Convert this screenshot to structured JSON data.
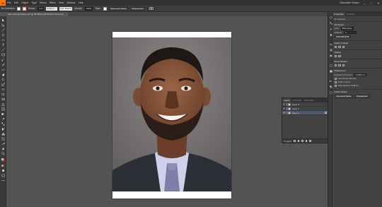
{
  "app": {
    "logo": "Ai",
    "menu": [
      "File",
      "Edit",
      "Object",
      "Type",
      "Select",
      "Effect",
      "View",
      "Window",
      "Help"
    ],
    "workspace": "Essentials Classic",
    "window_controls": [
      "–",
      "□",
      "✕"
    ]
  },
  "controlbar": {
    "selection_label": "No Selection",
    "stroke_label": "Stroke:",
    "stroke_value": "1 pt",
    "stroke_style": "Uniform",
    "brush": "5 pt. Round",
    "opacity_label": "Opacity:",
    "opacity_value": "100%",
    "style_label": "Style:",
    "document_setup": "Document Setup",
    "preferences": "Preferences"
  },
  "document": {
    "tab_title": "will-smith illustration.ai* @ 38.95% (CMYK/GPU Preview)",
    "close": "×"
  },
  "layers_panel": {
    "tabs": [
      "Layers",
      "Artboards",
      "Properties"
    ],
    "layers": [
      {
        "name": "Layer 3",
        "color": "#e06ad6",
        "selected": false
      },
      {
        "name": "Layer 2",
        "color": "#53c353",
        "selected": false
      },
      {
        "name": "Layer 1",
        "color": "#3f86ff",
        "selected": true
      }
    ],
    "footer_count": "3 Layers"
  },
  "properties_panel": {
    "tabs": [
      "Properties",
      "Libraries"
    ],
    "selection_text": "No Selection",
    "document_head": "Document",
    "units_label": "Units:",
    "units_value": "Millimeters",
    "artboard_label": "Artboard:",
    "artboard_value": "1",
    "edit_artboards": "Edit Artboards",
    "rulers_head": "Rulers & Grids",
    "guides_head": "Guides",
    "snap_head": "Snap Options",
    "prefs_head": "Preferences",
    "keyboard_inc_label": "Keyboard Increment:",
    "keyboard_inc_value": "0.3528 mm",
    "use_preview_bounds": "Use Preview Bounds",
    "scale_corners": "Scale Corners",
    "scale_strokes": "Scale Strokes & Effects",
    "quick_actions_head": "Quick Actions",
    "document_setup_btn": "Document Setup",
    "preferences_btn": "Preferences"
  },
  "colors": {
    "accent_orange": "#ff7c00",
    "ui_dark": "#323232",
    "ui_mid": "#424242",
    "canvas": "#535353",
    "selection_blue": "#4b5a66"
  }
}
